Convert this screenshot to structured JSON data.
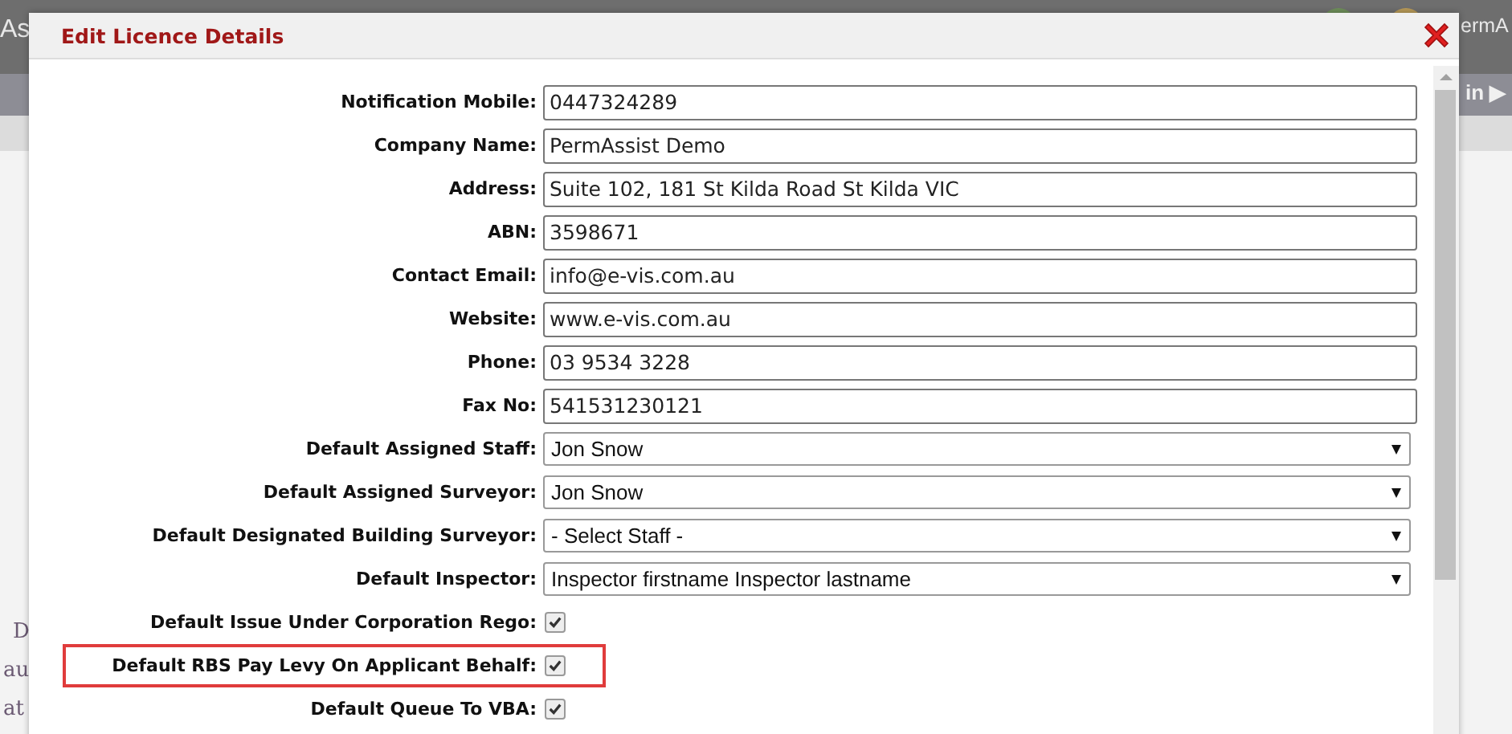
{
  "background": {
    "header_left": "As",
    "header_right": "ermA",
    "nav_button": "in ▶",
    "side_texts": [
      "D",
      "au",
      "at"
    ]
  },
  "dialog": {
    "title": "Edit Licence Details",
    "fields": [
      {
        "kind": "text",
        "label": "Notification Mobile:",
        "value": "0447324289"
      },
      {
        "kind": "text",
        "label": "Company Name:",
        "value": "PermAssist Demo"
      },
      {
        "kind": "text",
        "label": "Address:",
        "value": "Suite 102, 181 St Kilda Road St Kilda VIC"
      },
      {
        "kind": "text",
        "label": "ABN:",
        "value": "3598671"
      },
      {
        "kind": "text",
        "label": "Contact Email:",
        "value": "info@e-vis.com.au"
      },
      {
        "kind": "text",
        "label": "Website:",
        "value": "www.e-vis.com.au"
      },
      {
        "kind": "text",
        "label": "Phone:",
        "value": "03 9534 3228"
      },
      {
        "kind": "text",
        "label": "Fax No:",
        "value": "541531230121"
      },
      {
        "kind": "select",
        "label": "Default Assigned Staff:",
        "value": "Jon Snow"
      },
      {
        "kind": "select",
        "label": "Default Assigned Surveyor:",
        "value": "Jon Snow"
      },
      {
        "kind": "select",
        "label": "Default Designated Building Surveyor:",
        "value": "- Select Staff -"
      },
      {
        "kind": "select",
        "label": "Default Inspector:",
        "value": "Inspector firstname Inspector lastname"
      },
      {
        "kind": "checkbox",
        "label": "Default Issue Under Corporation Rego:",
        "checked": true,
        "highlighted": false
      },
      {
        "kind": "checkbox",
        "label": "Default RBS Pay Levy On Applicant Behalf:",
        "checked": true,
        "highlighted": true
      },
      {
        "kind": "checkbox",
        "label": "Default Queue To VBA:",
        "checked": true,
        "highlighted": false
      }
    ]
  }
}
